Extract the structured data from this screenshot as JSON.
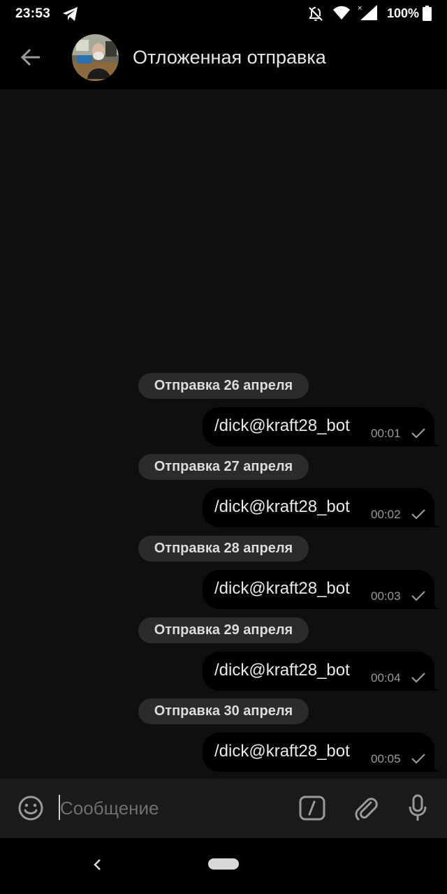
{
  "status_bar": {
    "time": "23:53",
    "battery": "100%",
    "icons": [
      "telegram-icon",
      "bell-off-icon",
      "wifi-icon",
      "signal-icon",
      "battery-icon"
    ]
  },
  "header": {
    "title": "Отложенная отправка",
    "icons": [
      "back-arrow-icon",
      "avatar"
    ]
  },
  "messages": [
    {
      "date": "Отправка 26 апреля",
      "text": "/dick@kraft28_bot",
      "time": "00:01"
    },
    {
      "date": "Отправка 27 апреля",
      "text": "/dick@kraft28_bot",
      "time": "00:02"
    },
    {
      "date": "Отправка 28 апреля",
      "text": "/dick@kraft28_bot",
      "time": "00:03"
    },
    {
      "date": "Отправка 29 апреля",
      "text": "/dick@kraft28_bot",
      "time": "00:04"
    },
    {
      "date": "Отправка 30 апреля",
      "text": "/dick@kraft28_bot",
      "time": "00:05"
    }
  ],
  "input_bar": {
    "placeholder": "Сообщение",
    "icons": [
      "emoji-icon",
      "bot-command-icon",
      "attach-icon",
      "microphone-icon"
    ]
  },
  "nav_bar": {
    "icons": [
      "nav-back-icon",
      "nav-home-pill"
    ]
  },
  "colors": {
    "background": "#0f0f0f",
    "bubble": "#000000",
    "date_pill": "#2b2b2b",
    "input_bar": "#1a1a1a"
  }
}
